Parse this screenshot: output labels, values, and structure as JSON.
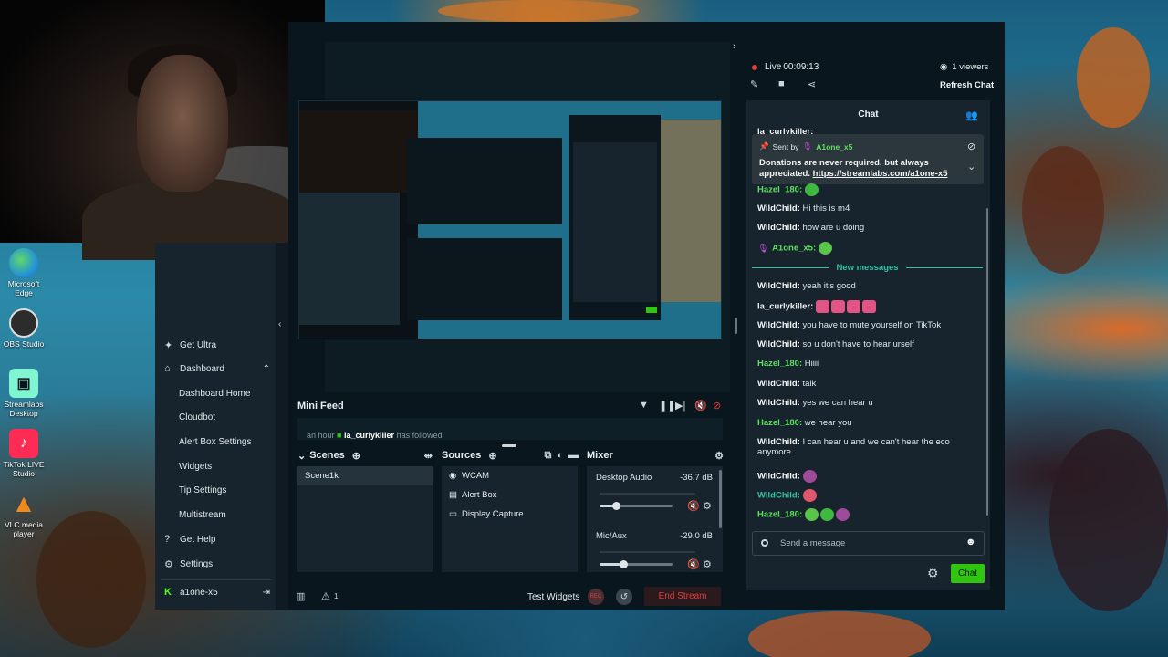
{
  "desktop": {
    "icons": [
      {
        "name": "edge",
        "label": "Microsoft Edge",
        "color": "#1e8be0"
      },
      {
        "name": "obs",
        "label": "OBS Studio",
        "color": "#2c2c2c"
      },
      {
        "name": "streamlabs",
        "label": "Streamlabs Desktop",
        "color": "#80f5d2"
      },
      {
        "name": "tiktok",
        "label": "TikTok LIVE Studio",
        "color": "#fe2c55"
      },
      {
        "name": "vlc",
        "label": "VLC media player",
        "color": "#f08a1c"
      }
    ]
  },
  "sidebar": {
    "get_ultra": "Get Ultra",
    "dashboard": "Dashboard",
    "sub_items": [
      "Dashboard Home",
      "Cloudbot",
      "Alert Box Settings",
      "Widgets",
      "Tip Settings",
      "Multistream"
    ],
    "get_help": "Get Help",
    "settings": "Settings",
    "account": "a1one-x5"
  },
  "editor": {
    "mini_feed": {
      "title": "Mini Feed",
      "event_prefix": "an hour",
      "event_user": "la_curlykiller",
      "event_action": "has followed"
    },
    "scenes": {
      "title": "Scenes",
      "items": [
        "Scene1k"
      ]
    },
    "sources": {
      "title": "Sources",
      "items": [
        {
          "label": "WCAM",
          "icon": "webcam-icon"
        },
        {
          "label": "Alert Box",
          "icon": "alert-box-icon"
        },
        {
          "label": "Display Capture",
          "icon": "monitor-icon"
        }
      ]
    },
    "mixer": {
      "title": "Mixer",
      "items": [
        {
          "name": "Desktop Audio",
          "db": "-36.7 dB",
          "level": 0.22
        },
        {
          "name": "Mic/Aux",
          "db": "-29.0 dB",
          "level": 0.33
        }
      ]
    },
    "footer": {
      "test_widgets": "Test Widgets",
      "rec": "REC",
      "end_stream": "End Stream",
      "alert_count": "1"
    }
  },
  "chat": {
    "live_label": "Live",
    "timer": "00:09:13",
    "viewers": "1 viewers",
    "refresh": "Refresh Chat",
    "title": "Chat",
    "pinned": {
      "sent_by_label": "Sent by",
      "sender": "A1one_x5",
      "text": "Donations are never required, but always appreciated.",
      "link": "https://streamlabs.com/a1one-x5"
    },
    "partial_top_user": "la_curlykiller:",
    "new_messages_label": "New messages",
    "messages": [
      {
        "user": "Hazel_180:",
        "text": "",
        "emotes": 1,
        "color": "green"
      },
      {
        "user": "WildChild:",
        "text": "Hi this is m4",
        "emotes": 0,
        "color": "white"
      },
      {
        "user": "WildChild:",
        "text": "how are u doing",
        "emotes": 0,
        "color": "white"
      },
      {
        "user": "A1one_x5:",
        "text": "",
        "emotes": 1,
        "color": "green"
      },
      {
        "user": "WildChild:",
        "text": "yeah it's good",
        "emotes": 0,
        "color": "white"
      },
      {
        "user": "la_curlykiller:",
        "text": "",
        "emotes": 4,
        "color": "white"
      },
      {
        "user": "WildChild:",
        "text": "you have to mute yourself on TikTok",
        "emotes": 0,
        "color": "white"
      },
      {
        "user": "WildChild:",
        "text": "so u don't have to hear urself",
        "emotes": 0,
        "color": "white"
      },
      {
        "user": "Hazel_180:",
        "text": "Hiiii",
        "emotes": 0,
        "color": "green"
      },
      {
        "user": "WildChild:",
        "text": "talk",
        "emotes": 0,
        "color": "white"
      },
      {
        "user": "WildChild:",
        "text": "yes we can hear u",
        "emotes": 0,
        "color": "white"
      },
      {
        "user": "Hazel_180:",
        "text": "we hear you",
        "emotes": 0,
        "color": "green"
      },
      {
        "user": "WildChild:",
        "text": "I can hear u and we can't hear the eco",
        "text2": "anymore",
        "emotes": 0,
        "color": "white"
      },
      {
        "user": "WildChild:",
        "text": "",
        "emotes": 1,
        "color": "white"
      },
      {
        "user": "WildChild:",
        "text": "",
        "emotes": 1,
        "color": "teal"
      },
      {
        "user": "Hazel_180:",
        "text": "",
        "emotes": 3,
        "color": "green"
      }
    ],
    "input_placeholder": "Send a message",
    "send_button": "Chat"
  }
}
